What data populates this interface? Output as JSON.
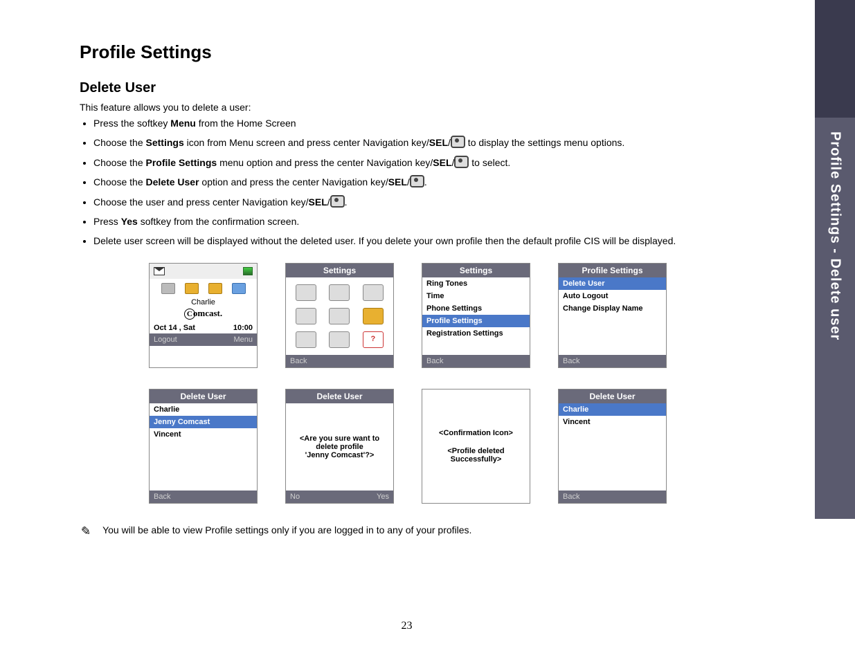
{
  "sidebar_label": "Profile Settings - Delete user",
  "title": "Profile Settings",
  "section": "Delete User",
  "intro": "This feature allows you to delete a user:",
  "steps": {
    "s1_a": "Press the softkey ",
    "s1_b": "Menu",
    "s1_c": " from the Home Screen",
    "s2_a": "Choose the ",
    "s2_b": "Settings",
    "s2_c": " icon from Menu screen and press center Navigation key/",
    "s2_d": "SEL",
    "s2_e": " to display the settings menu options.",
    "s3_a": "Choose the ",
    "s3_b": "Profile Settings",
    "s3_c": " menu option and press the center Navigation key/",
    "s3_d": "SEL",
    "s3_e": " to select.",
    "s4_a": "Choose the ",
    "s4_b": "Delete User",
    "s4_c": " option and press the center Navigation key/",
    "s4_d": "SEL",
    "s4_e": ".",
    "s5_a": "Choose the user and press center Navigation key/",
    "s5_b": "SEL",
    "s5_c": ".",
    "s6_a": "Press ",
    "s6_b": "Yes",
    "s6_c": " softkey from the confirmation screen.",
    "s7": "Delete user screen will be displayed without the deleted user. If you delete your own profile then the default profile CIS will be displayed."
  },
  "note": "You will be able to view Profile settings only if you are logged in to any of your profiles.",
  "page_number": "23",
  "shots": {
    "home": {
      "name": "Charlie",
      "logo": "omcast.",
      "date": "Oct 14 , Sat",
      "time": "10:00",
      "left": "Logout",
      "right": "Menu"
    },
    "menu": {
      "title": "Settings",
      "left": "Back",
      "q": "?"
    },
    "settings_list": {
      "title": "Settings",
      "items": [
        "Ring Tones",
        "Time",
        "Phone Settings",
        "Profile Settings",
        "Registration Settings"
      ],
      "selected": 3,
      "left": "Back"
    },
    "profile_settings": {
      "title": "Profile Settings",
      "items": [
        "Delete User",
        "Auto Logout",
        "Change Display Name"
      ],
      "selected": 0,
      "left": "Back"
    },
    "delete_user_list": {
      "title": "Delete User",
      "items": [
        "Charlie",
        "Jenny Comcast",
        "Vincent"
      ],
      "selected": 1,
      "left": "Back"
    },
    "confirm": {
      "title": "Delete User",
      "line1": "<Are you sure want to",
      "line2": "delete profile",
      "line3": "'Jenny Comcast'?>",
      "left": "No",
      "right": "Yes"
    },
    "success": {
      "line1": "<Confirmation Icon>",
      "line2": "<Profile deleted",
      "line3": "Successfully>"
    },
    "after": {
      "title": "Delete User",
      "items": [
        "Charlie",
        "Vincent"
      ],
      "selected": 0,
      "left": "Back"
    }
  }
}
